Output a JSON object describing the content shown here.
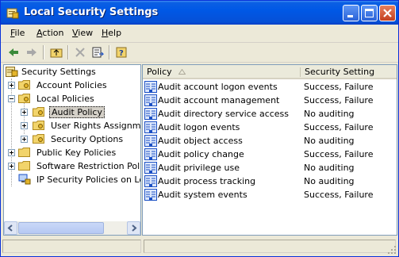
{
  "window": {
    "title": "Local Security Settings",
    "controls": {
      "minimize": "minimize",
      "maximize": "maximize",
      "close": "close"
    }
  },
  "menu": [
    "File",
    "Action",
    "View",
    "Help"
  ],
  "toolbar": {
    "buttons": [
      "back-icon",
      "forward-icon",
      "up-one-level-icon",
      "delete-icon",
      "export-list-icon",
      "help-icon"
    ]
  },
  "tree": {
    "root": "Security Settings",
    "items": [
      {
        "label": "Account Policies",
        "expanded": false
      },
      {
        "label": "Local Policies",
        "expanded": true
      },
      {
        "label": "Audit Policy",
        "selected": true
      },
      {
        "label": "User Rights Assignment"
      },
      {
        "label": "Security Options"
      },
      {
        "label": "Public Key Policies",
        "expanded": false
      },
      {
        "label": "Software Restriction Policies",
        "expanded": false
      },
      {
        "label": "IP Security Policies on Local Computer"
      }
    ]
  },
  "list": {
    "columns": [
      "Policy",
      "Security Setting"
    ],
    "sort_column": "Policy",
    "rows": [
      {
        "policy": "Audit account logon events",
        "setting": "Success, Failure"
      },
      {
        "policy": "Audit account management",
        "setting": "Success, Failure"
      },
      {
        "policy": "Audit directory service access",
        "setting": "No auditing"
      },
      {
        "policy": "Audit logon events",
        "setting": "Success, Failure"
      },
      {
        "policy": "Audit object access",
        "setting": "No auditing"
      },
      {
        "policy": "Audit policy change",
        "setting": "Success, Failure"
      },
      {
        "policy": "Audit privilege use",
        "setting": "No auditing"
      },
      {
        "policy": "Audit process tracking",
        "setting": "No auditing"
      },
      {
        "policy": "Audit system events",
        "setting": "Success, Failure"
      }
    ]
  },
  "colors": {
    "titlebar": "#0058e6",
    "chrome": "#ece9d8",
    "border": "#7f9db9"
  }
}
